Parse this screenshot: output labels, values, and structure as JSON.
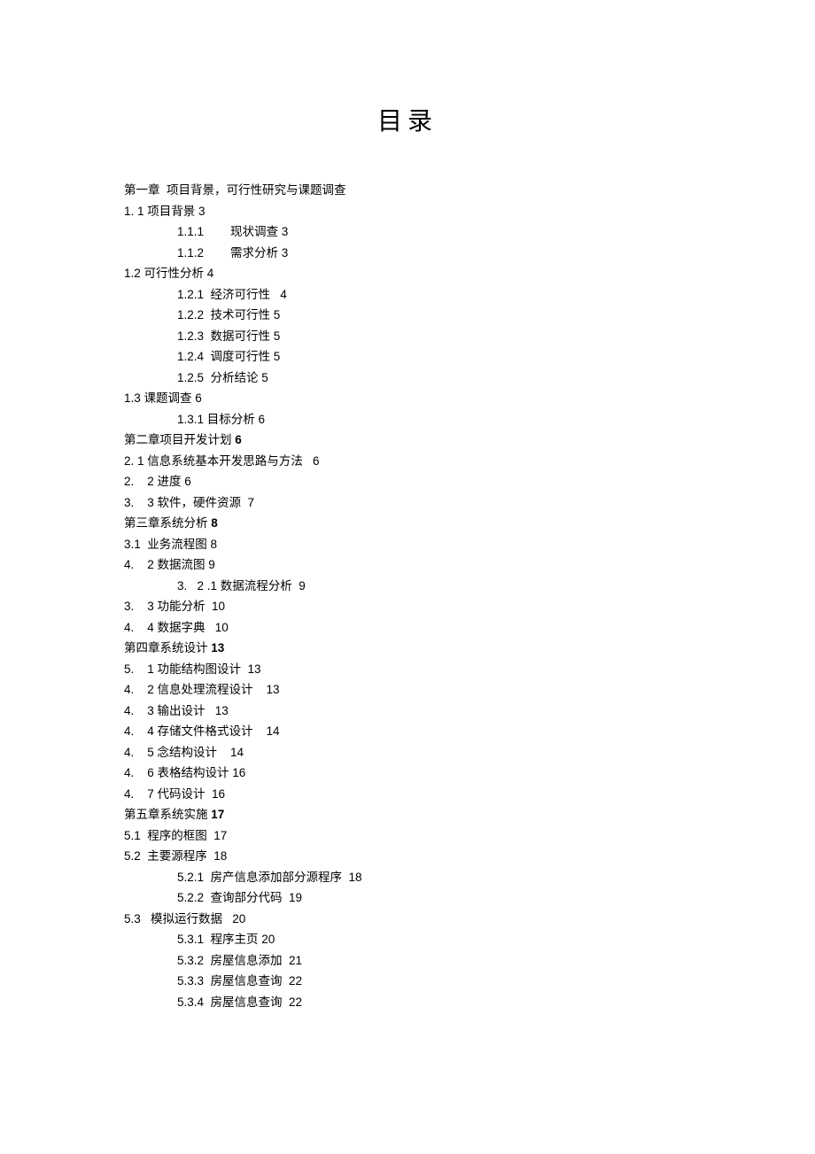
{
  "title": "目录",
  "lines": [
    {
      "indent": 0,
      "text": "第一章  项目背景，可行性研究与课题调查"
    },
    {
      "indent": 0,
      "text": "1. 1 项目背景 3"
    },
    {
      "indent": 1,
      "text": "1.1.1        现状调查 3"
    },
    {
      "indent": 1,
      "text": "1.1.2        需求分析 3"
    },
    {
      "indent": 0,
      "text": "1.2 可行性分析 4"
    },
    {
      "indent": 1,
      "text": "1.2.1  经济可行性   4"
    },
    {
      "indent": 1,
      "text": "1.2.2  技术可行性 5"
    },
    {
      "indent": 1,
      "text": "1.2.3  数据可行性 5"
    },
    {
      "indent": 1,
      "text": "1.2.4  调度可行性 5"
    },
    {
      "indent": 1,
      "text": "1.2.5  分析结论 5"
    },
    {
      "indent": 0,
      "text": "1.3 课题调查 6"
    },
    {
      "indent": 1,
      "text": "1.3.1 目标分析 6"
    },
    {
      "indent": 0,
      "text": "第二章项目开发计划 ",
      "page": "6"
    },
    {
      "indent": 0,
      "text": "2. 1 信息系统基本开发思路与方法   6"
    },
    {
      "indent": 0,
      "text": "2.    2 进度 6"
    },
    {
      "indent": 0,
      "text": "3.    3 软件，硬件资源  7"
    },
    {
      "indent": 0,
      "text": "第三章系统分析 ",
      "page": "8"
    },
    {
      "indent": 0,
      "text": "3.1  业务流程图 8"
    },
    {
      "indent": 0,
      "text": "4.    2 数据流图 9"
    },
    {
      "indent": 1,
      "text": "3.   2 .1 数据流程分析  9"
    },
    {
      "indent": 0,
      "text": "3.    3 功能分析  10"
    },
    {
      "indent": 0,
      "text": "4.    4 数据字典   10"
    },
    {
      "indent": 0,
      "text": "第四章系统设计 ",
      "page": "13"
    },
    {
      "indent": 0,
      "text": "5.    1 功能结构图设计  13"
    },
    {
      "indent": 0,
      "text": "4.    2 信息处理流程设计    13"
    },
    {
      "indent": 0,
      "text": "4.    3 输出设计   13"
    },
    {
      "indent": 0,
      "text": "4.    4 存储文件格式设计    14"
    },
    {
      "indent": 0,
      "text": "4.    5 念结构设计    14"
    },
    {
      "indent": 0,
      "text": "4.    6 表格结构设计 16"
    },
    {
      "indent": 0,
      "text": "4.    7 代码设计  16"
    },
    {
      "indent": 0,
      "text": "第五章系统实施 ",
      "page": "17"
    },
    {
      "indent": 0,
      "text": "5.1  程序的框图  17"
    },
    {
      "indent": 0,
      "text": "5.2  主要源程序  18"
    },
    {
      "indent": 1,
      "text": "5.2.1  房产信息添加部分源程序  18"
    },
    {
      "indent": 1,
      "text": "5.2.2  查询部分代码  19"
    },
    {
      "indent": 0,
      "text": "5.3   模拟运行数据   20"
    },
    {
      "indent": 1,
      "text": "5.3.1  程序主页 20"
    },
    {
      "indent": 1,
      "text": "5.3.2  房屋信息添加  21"
    },
    {
      "indent": 1,
      "text": "5.3.3  房屋信息查询  22"
    },
    {
      "indent": 1,
      "text": "5.3.4  房屋信息查询  22"
    }
  ]
}
